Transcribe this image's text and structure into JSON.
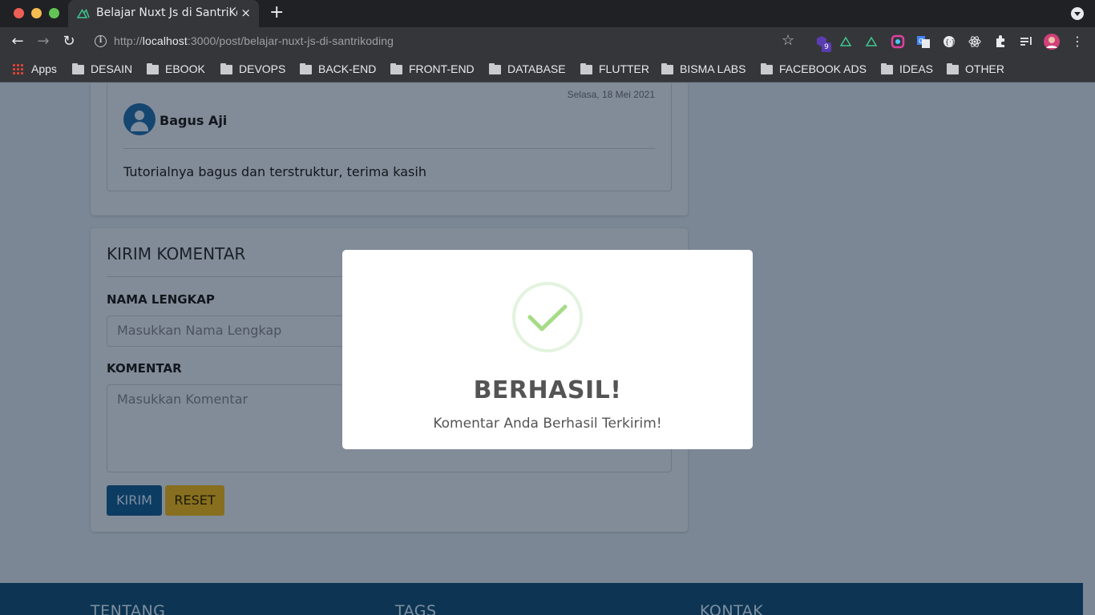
{
  "browser": {
    "tab_title": "Belajar Nuxt Js di SantriKoding",
    "tab_close": "×",
    "new_tab": "+",
    "url_host": "localhost",
    "url_prefix": "http://",
    "url_rest": ":3000/post/belajar-nuxt-js-di-santrikoding",
    "extension_badge": "9"
  },
  "bookmarks": {
    "apps": "Apps",
    "folders": [
      "DESAIN",
      "EBOOK",
      "DEVOPS",
      "BACK-END",
      "FRONT-END",
      "DATABASE",
      "FLUTTER",
      "BISMA LABS",
      "FACEBOOK ADS",
      "IDEAS",
      "OTHER"
    ]
  },
  "comment": {
    "date": "Selasa, 18 Mei 2021",
    "author": "Bagus Aji",
    "text": "Tutorialnya bagus dan terstruktur, terima kasih"
  },
  "form": {
    "title": "KIRIM KOMENTAR",
    "name_label": "NAMA LENGKAP",
    "name_placeholder": "Masukkan Nama Lengkap",
    "comment_label": "KOMENTAR",
    "comment_placeholder": "Masukkan Komentar",
    "submit_label": "KIRIM",
    "reset_label": "RESET"
  },
  "footer": {
    "headings": [
      "TENTANG",
      "TAGS",
      "KONTAK"
    ]
  },
  "modal": {
    "title": "BERHASIL!",
    "message": "Komentar Anda Berhasil Terkirim!",
    "icon": "success-check-icon",
    "accent_color": "#a5dc86"
  }
}
